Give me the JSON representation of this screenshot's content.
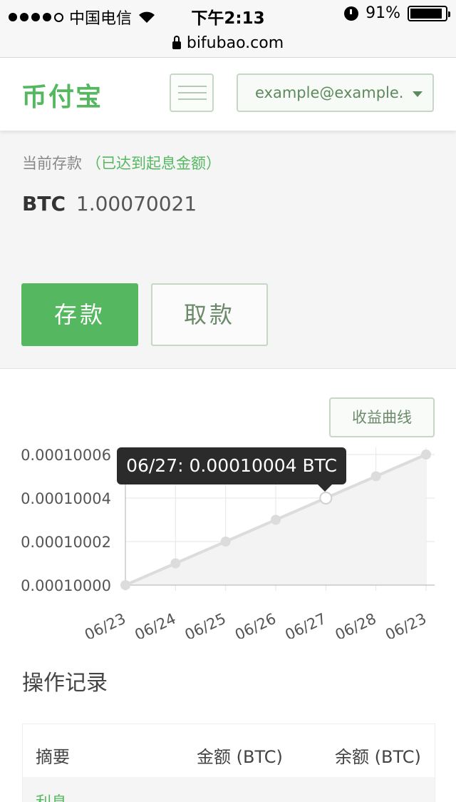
{
  "status_bar": {
    "carrier": "中国电信",
    "time": "下午2:13",
    "battery": "91%",
    "battery_level": 0.91
  },
  "url_bar": {
    "url": "bifubao.com"
  },
  "header": {
    "logo": "币付宝",
    "account_label": "example@example.",
    "menu_icon": "hamburger-icon"
  },
  "deposit": {
    "label": "当前存款",
    "note": "（已达到起息金额）",
    "currency": "BTC",
    "amount": "1.00070021",
    "deposit_button": "存款",
    "withdraw_button": "取款"
  },
  "chart": {
    "toggle_label": "收益曲线",
    "tooltip": "06/27: 0.00010004 BTC",
    "accent": "#55b861"
  },
  "chart_data": {
    "type": "line",
    "categories": [
      "06/23",
      "06/24",
      "06/25",
      "06/26",
      "06/27",
      "06/28",
      "06/23"
    ],
    "values": [
      0.0001,
      0.00010001,
      0.00010002,
      0.00010003,
      0.00010004,
      0.00010005,
      0.00010006
    ],
    "yticks": [
      "0.00010000",
      "0.00010002",
      "0.00010004",
      "0.00010006"
    ],
    "ylim": [
      0.0001,
      0.00010006
    ],
    "title": "",
    "xlabel": "",
    "ylabel": "",
    "grid": true,
    "highlight_index": 4
  },
  "records": {
    "title": "操作记录",
    "columns": [
      "摘要",
      "金额 (BTC)",
      "余额 (BTC)"
    ],
    "rows": [
      {
        "summary": "利息"
      }
    ]
  }
}
